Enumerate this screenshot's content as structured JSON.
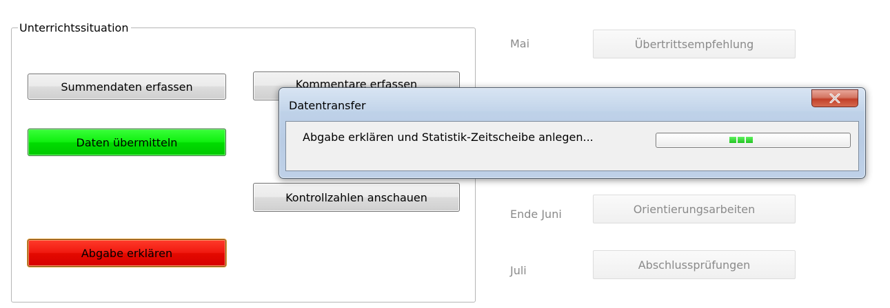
{
  "unterricht": {
    "group_title": "Unterrichtssituation",
    "buttons": {
      "summendaten": "Summendaten erfassen",
      "kommentare": "Kommentare erfassen",
      "daten": "Daten übermitteln",
      "kontrollzahlen": "Kontrollzahlen anschauen",
      "abgabe": "Abgabe erklären"
    }
  },
  "timeline": {
    "items": [
      {
        "label": "Mai",
        "button": "Übertrittsempfehlung"
      },
      {
        "label": "Ende Juni",
        "button": "Orientierungsarbeiten"
      },
      {
        "label": "Juli",
        "button": "Abschlussprüfungen"
      }
    ]
  },
  "dialog": {
    "title": "Datentransfer",
    "message": "Abgabe erklären und Statistik-Zeitscheibe anlegen...",
    "close_icon": "close-icon",
    "progress_state": "marquee"
  },
  "colors": {
    "green_button": "#00dc00",
    "red_button": "#e40a00",
    "dialog_frame": "#bfd1e8",
    "close_button": "#c2402a"
  }
}
